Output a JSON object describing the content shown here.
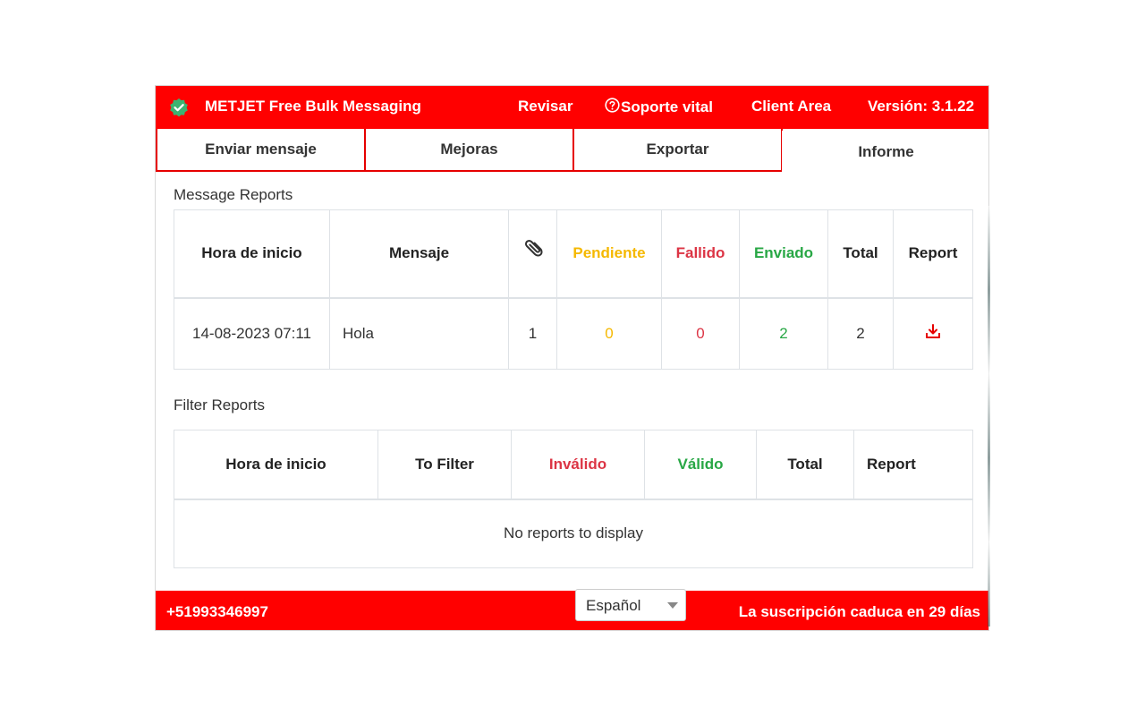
{
  "header": {
    "brand": "METJET Free Bulk Messaging",
    "nav": {
      "revisar": "Revisar",
      "soporte": "Soporte vital",
      "client_area": "Client Area"
    },
    "version": "Versión: 3.1.22"
  },
  "tabs": [
    {
      "label": "Enviar mensaje"
    },
    {
      "label": "Mejoras"
    },
    {
      "label": "Exportar"
    },
    {
      "label": "Informe",
      "active": true
    }
  ],
  "message_reports": {
    "title": "Message Reports",
    "columns": {
      "start_time": "Hora de inicio",
      "message": "Mensaje",
      "pending": "Pendiente",
      "failed": "Fallido",
      "sent": "Enviado",
      "total": "Total",
      "report": "Report"
    },
    "rows": [
      {
        "start_time": "14-08-2023 07:11",
        "message": "Hola",
        "attachments": "1",
        "pending": "0",
        "failed": "0",
        "sent": "2",
        "total": "2"
      }
    ]
  },
  "filter_reports": {
    "title": "Filter Reports",
    "columns": {
      "start_time": "Hora de inicio",
      "to_filter": "To Filter",
      "invalid": "Inválido",
      "valid": "Válido",
      "total": "Total",
      "report": "Report"
    },
    "empty_text": "No reports to display"
  },
  "footer": {
    "phone": "+51993346997",
    "language": "Español",
    "expiry": "La suscripción caduca en 29 días"
  },
  "colors": {
    "brand_red": "#ff0000",
    "pending": "#f5b800",
    "failed": "#dc3545",
    "sent": "#28a745"
  }
}
